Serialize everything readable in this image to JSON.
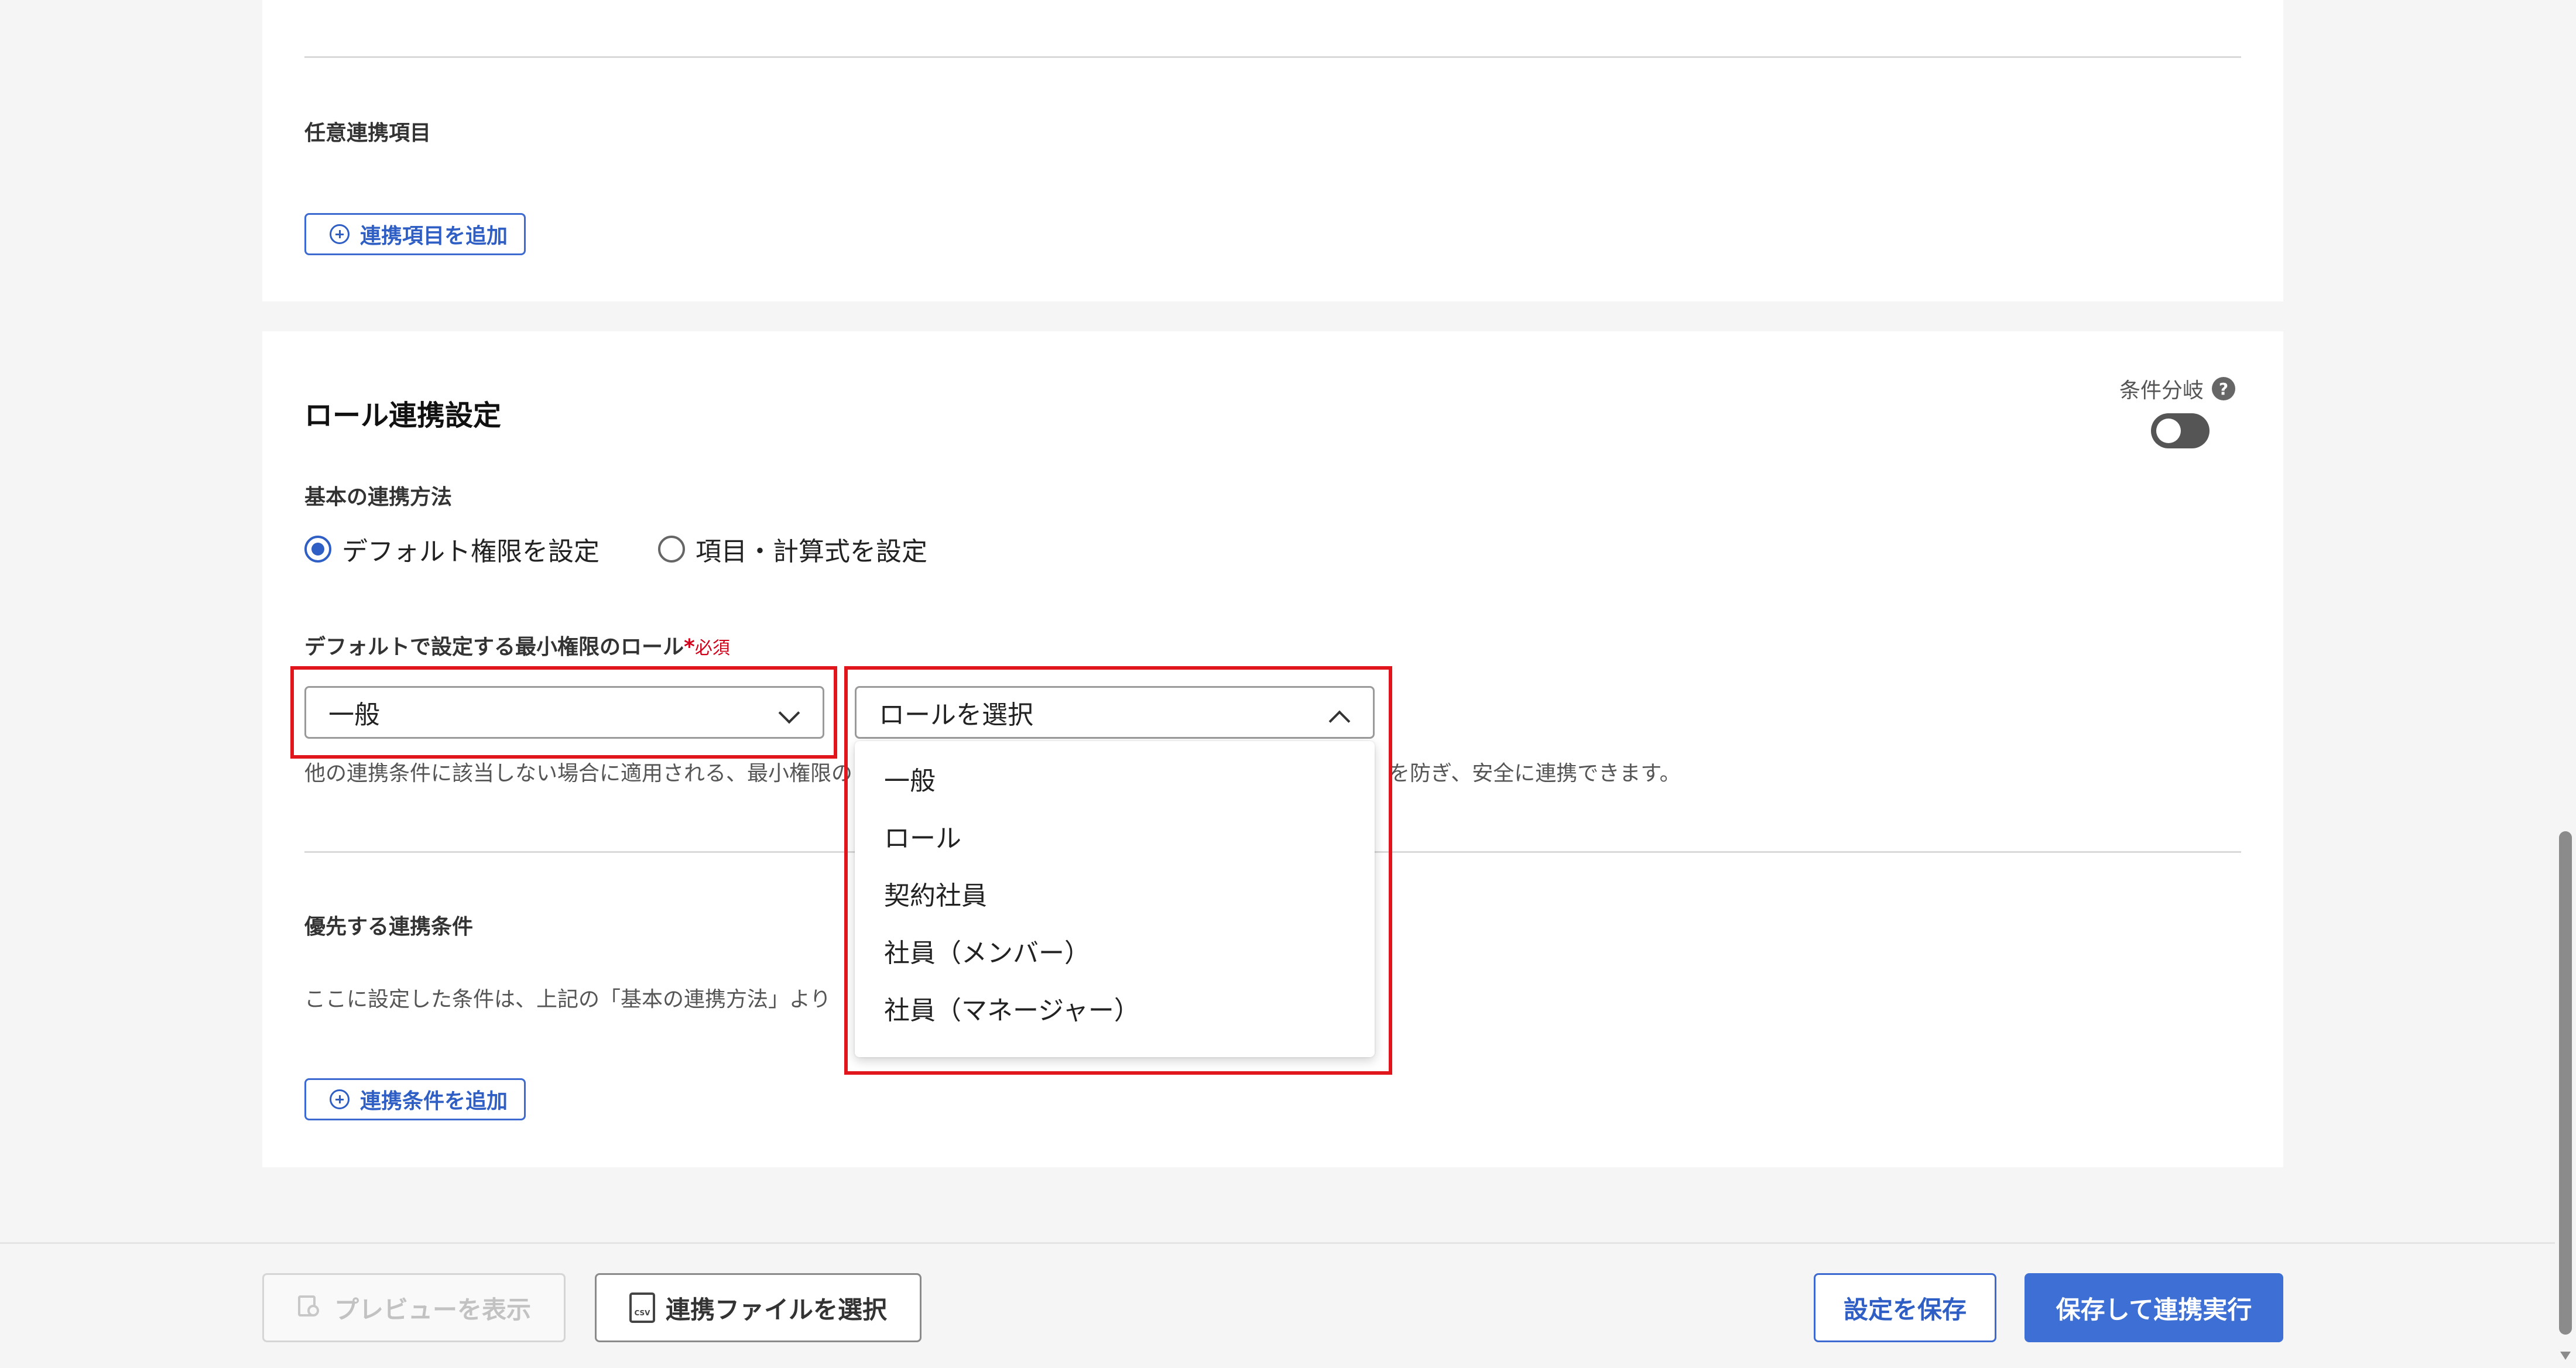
{
  "optional_section": {
    "label": "任意連携項目",
    "add_button": "連携項目を追加"
  },
  "role_section": {
    "title": "ロール連携設定",
    "condition_branch": {
      "label": "条件分岐",
      "help_icon": "question-circle-icon",
      "toggle_on": false
    },
    "basic_method": {
      "label": "基本の連携方法",
      "options": [
        {
          "label": "デフォルト権限を設定",
          "checked": true
        },
        {
          "label": "項目・計算式を設定",
          "checked": false
        }
      ]
    },
    "default_role": {
      "label": "デフォルトで設定する最小権限のロール",
      "required_mark": "*",
      "required_text": "必須",
      "selected_value": "一般",
      "second_select_placeholder": "ロールを選択",
      "dropdown_options": [
        "一般",
        "ロール",
        "契約社員",
        "社員（メンバー）",
        "社員（マネージャー）"
      ],
      "help_text_left": "他の連携条件に該当しない場合に適用される、最小権限の",
      "help_text_right": "を防ぎ、安全に連携できます。"
    },
    "priority": {
      "label": "優先する連携条件",
      "help_text": "ここに設定した条件は、上記の「基本の連携方法」より",
      "add_button": "連携条件を追加"
    }
  },
  "footer": {
    "preview_button": "プレビューを表示",
    "select_file_button": "連携ファイルを選択",
    "csv_icon_text": "CSV",
    "save_button": "設定を保存",
    "save_and_run_button": "保存して連携実行"
  },
  "colors": {
    "accent": "#3e6fd4",
    "highlight": "#e0161c",
    "required": "#d0021b"
  }
}
